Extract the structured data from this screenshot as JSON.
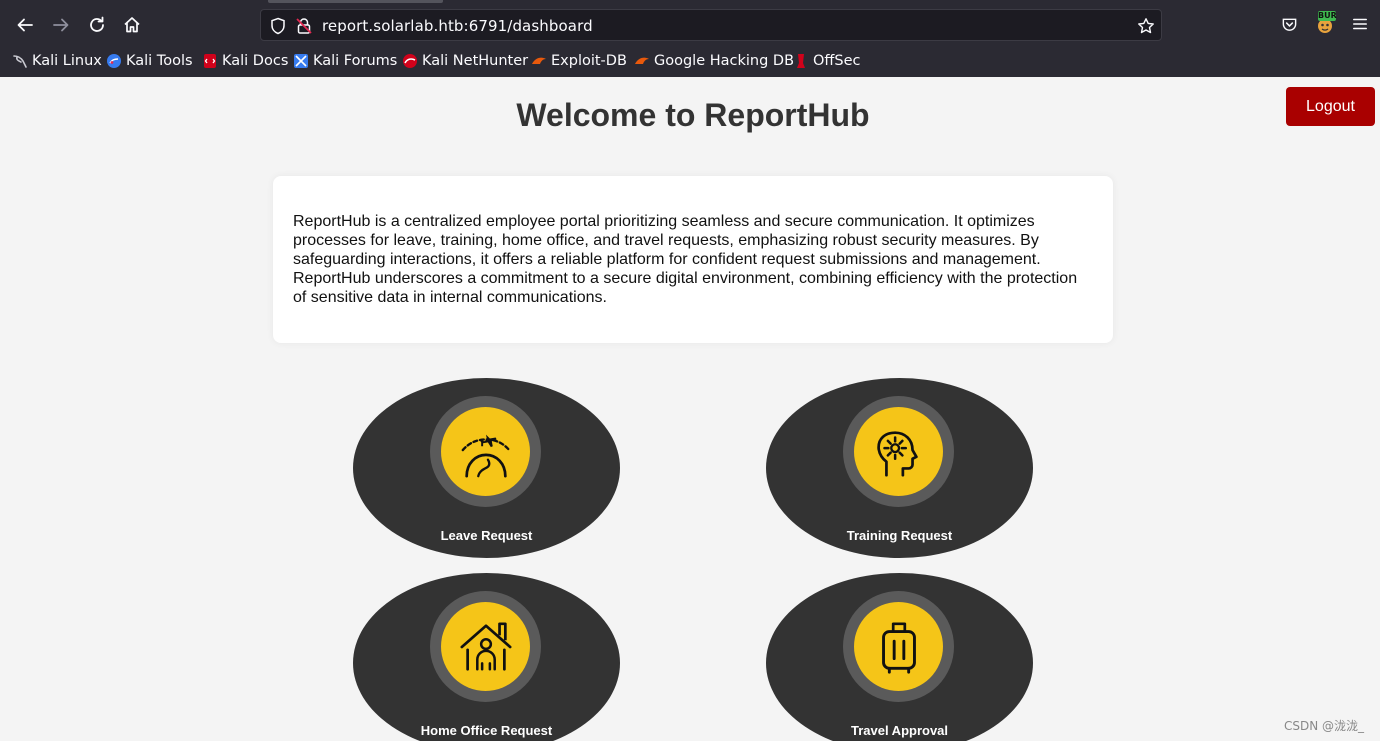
{
  "browser": {
    "url": "report.solarlab.htb:6791/dashboard",
    "bookmarks": [
      {
        "label": "Kali Linux",
        "icon": "kali-dragon-icon",
        "color": "#367bf0"
      },
      {
        "label": "Kali Tools",
        "icon": "kali-tools-icon",
        "color": "#367bf0"
      },
      {
        "label": "Kali Docs",
        "icon": "kali-docs-icon",
        "color": "#d0021b"
      },
      {
        "label": "Kali Forums",
        "icon": "kali-forums-icon",
        "color": "#367bf0"
      },
      {
        "label": "Kali NetHunter",
        "icon": "nethunter-icon",
        "color": "#d0021b"
      },
      {
        "label": "Exploit-DB",
        "icon": "exploit-db-icon",
        "color": "#e8590c"
      },
      {
        "label": "Google Hacking DB",
        "icon": "ghdb-icon",
        "color": "#e8590c"
      },
      {
        "label": "OffSec",
        "icon": "offsec-icon",
        "color": "#d0021b"
      }
    ],
    "burp_badge": "BUR"
  },
  "page": {
    "title": "Welcome to ReportHub",
    "logout_label": "Logout",
    "intro": "ReportHub is a centralized employee portal prioritizing seamless and secure communication. It optimizes processes for leave, training, home office, and travel requests, emphasizing robust security measures. By safeguarding interactions, it offers a reliable platform for confident request submissions and management. ReportHub underscores a commitment to a secure digital environment, combining efficiency with the protection of sensitive data in internal communications.",
    "tiles": [
      {
        "label": "Leave Request",
        "icon": "airplane-globe-icon"
      },
      {
        "label": "Training Request",
        "icon": "head-gear-icon"
      },
      {
        "label": "Home Office Request",
        "icon": "house-person-icon"
      },
      {
        "label": "Travel Approval",
        "icon": "luggage-icon"
      }
    ]
  },
  "watermark": "CSDN @泷泷_",
  "colors": {
    "accent": "#f5c518",
    "logout": "#a90000",
    "tile": "#333333",
    "chrome": "#2b2a33"
  }
}
